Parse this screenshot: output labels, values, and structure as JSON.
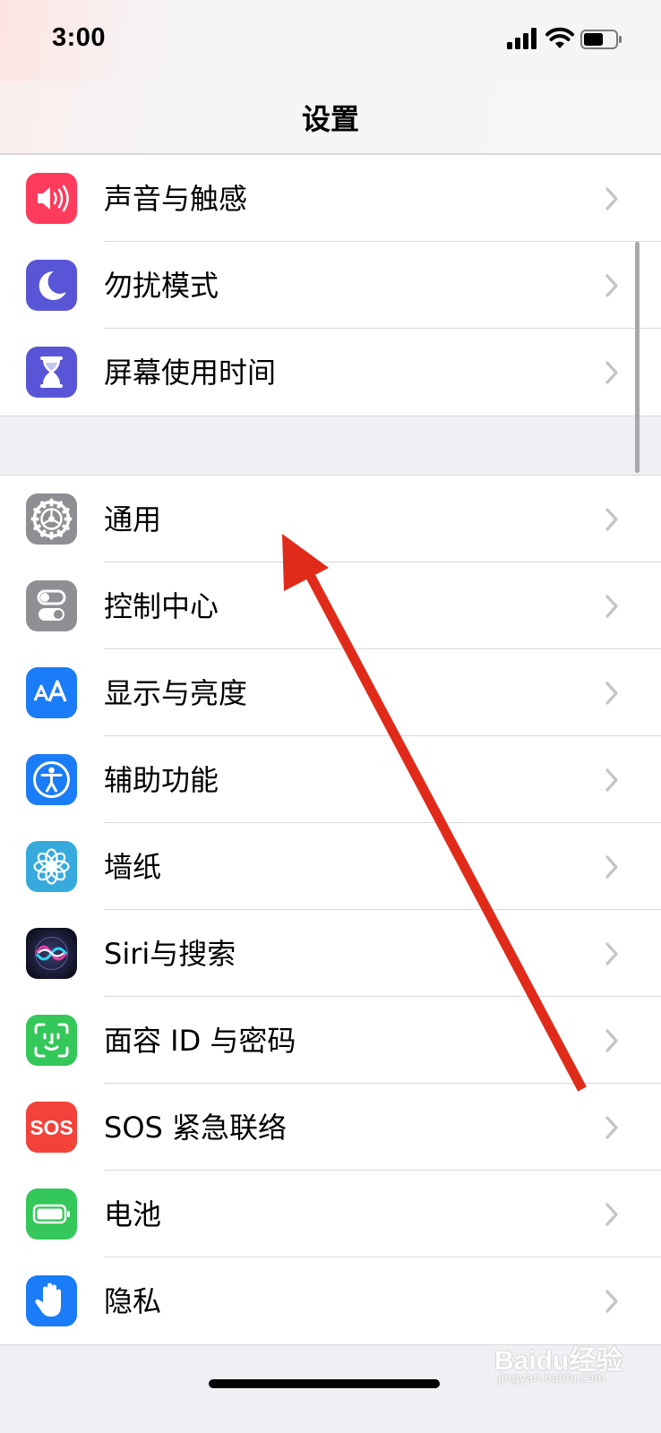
{
  "status_bar": {
    "time": "3:00"
  },
  "nav": {
    "title": "设置"
  },
  "group1": [
    {
      "label": "声音与触感",
      "icon": "speaker-icon",
      "color": "#fd3b5c"
    },
    {
      "label": "勿扰模式",
      "icon": "moon-icon",
      "color": "#5856d6"
    },
    {
      "label": "屏幕使用时间",
      "icon": "hourglass-icon",
      "color": "#5856d6"
    }
  ],
  "group2": [
    {
      "label": "通用",
      "icon": "gear-icon",
      "color": "#8e8e93"
    },
    {
      "label": "控制中心",
      "icon": "toggles-icon",
      "color": "#8e8e93"
    },
    {
      "label": "显示与亮度",
      "icon": "text-size-icon",
      "color": "#1a7cf6"
    },
    {
      "label": "辅助功能",
      "icon": "accessibility-icon",
      "color": "#1a7cf6"
    },
    {
      "label": "墙纸",
      "icon": "flower-icon",
      "color": "#36aadc"
    },
    {
      "label": "Siri与搜索",
      "icon": "siri-icon",
      "color": "#1b1b3a"
    },
    {
      "label": "面容 ID 与密码",
      "icon": "face-id-icon",
      "color": "#34c759"
    },
    {
      "label": "SOS 紧急联络",
      "icon": "sos-icon",
      "color": "#f2423a",
      "icon_text": "SOS"
    },
    {
      "label": "电池",
      "icon": "battery-icon",
      "color": "#34c759"
    },
    {
      "label": "隐私",
      "icon": "hand-icon",
      "color": "#1a7cf6"
    }
  ],
  "watermark": {
    "brand": "Baidu经验",
    "url": "jingyan.baidu.com"
  },
  "annotation": {
    "color": "#e02b1a"
  }
}
